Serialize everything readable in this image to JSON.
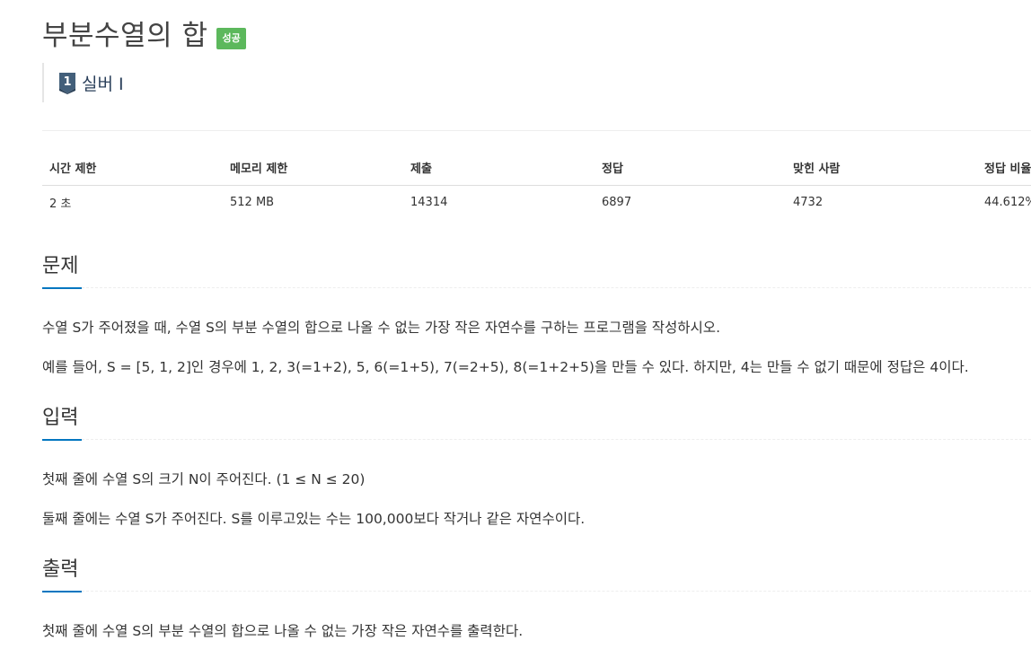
{
  "problem": {
    "title": "부분수열의 합",
    "status_badge": "성공",
    "tier_number": "1",
    "tier_label": "실버 I"
  },
  "info_table": {
    "headers": [
      "시간 제한",
      "메모리 제한",
      "제출",
      "정답",
      "맞힌 사람",
      "정답 비율"
    ],
    "values": [
      "2 초",
      "512 MB",
      "14314",
      "6897",
      "4732",
      "44.612%"
    ]
  },
  "sections": {
    "problem": {
      "heading": "문제",
      "paragraphs": [
        "수열 S가 주어졌을 때, 수열 S의 부분 수열의 합으로 나올 수 없는 가장 작은 자연수를 구하는 프로그램을 작성하시오.",
        "예를 들어, S = [5, 1, 2]인 경우에 1, 2, 3(=1+2), 5, 6(=1+5), 7(=2+5), 8(=1+2+5)을 만들 수 있다. 하지만, 4는 만들 수 없기 때문에 정답은 4이다."
      ]
    },
    "input": {
      "heading": "입력",
      "paragraphs": [
        "첫째 줄에 수열 S의 크기 N이 주어진다. (1 ≤ N ≤ 20)",
        "둘째 줄에는 수열 S가 주어진다. S를 이루고있는 수는 100,000보다 작거나 같은 자연수이다."
      ]
    },
    "output": {
      "heading": "출력",
      "paragraphs": [
        "첫째 줄에 수열 S의 부분 수열의 합으로 나올 수 없는 가장 작은 자연수를 출력한다."
      ]
    }
  },
  "colors": {
    "badge_success": "#5cb85c",
    "heading_accent": "#0076c0",
    "tier_icon": "#435f7a"
  },
  "icons": {
    "tier": "silver-tier-icon"
  }
}
